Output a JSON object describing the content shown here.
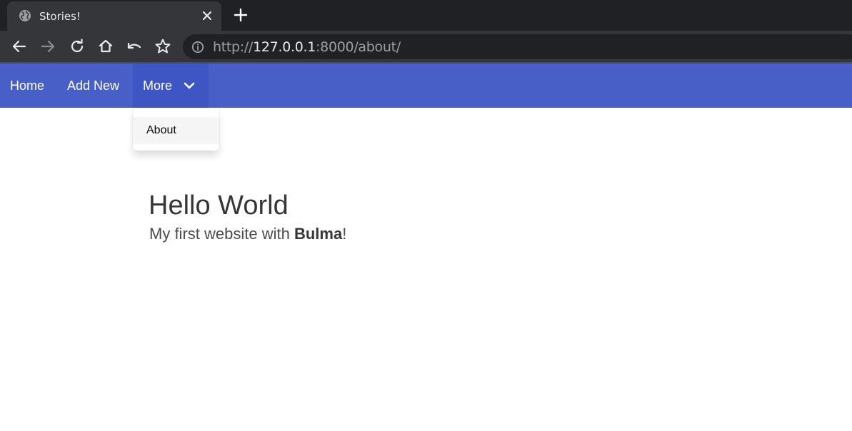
{
  "browser": {
    "tab": {
      "title": "Stories!",
      "favicon": "globe-icon"
    },
    "toolbar": {
      "url_scheme": "http://",
      "url_host": "127.0.0.1",
      "url_rest": ":8000/about/"
    }
  },
  "navbar": {
    "color": "#485fc7",
    "items": [
      {
        "label": "Home"
      },
      {
        "label": "Add New"
      }
    ],
    "more": {
      "label": "More",
      "icon": "chevron-down-icon"
    },
    "dropdown": {
      "items": [
        {
          "label": "About"
        }
      ]
    }
  },
  "hero": {
    "title": "Hello World",
    "subtitle_prefix": "My first website with ",
    "subtitle_strong": "Bulma",
    "subtitle_suffix": "!"
  }
}
